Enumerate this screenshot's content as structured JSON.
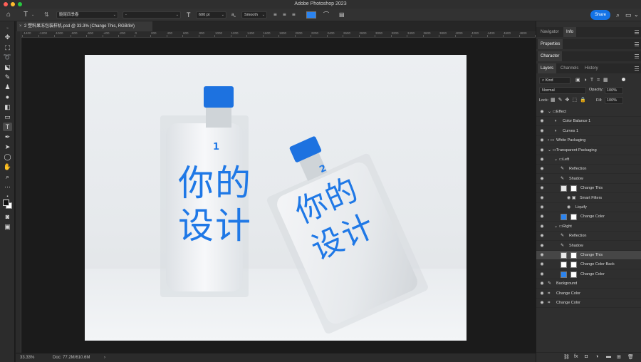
{
  "window": {
    "title": "Adobe Photoshop 2023"
  },
  "options": {
    "font_family": "髓尾四季春",
    "font_style": "-",
    "font_size": "600 pt",
    "antialias_label": "a",
    "antialias": "Smooth",
    "text_color": "#2b84f0",
    "share": "Share"
  },
  "document": {
    "tab_title": "2 塑料果冻包装样机.psd @ 33.3% (Change This, RGB/8#)",
    "zoom": "33.33%",
    "doc_size": "Doc: 77.2M/610.6M",
    "status_arrow": "›"
  },
  "rulers": {
    "top_labels": [
      "-1400",
      "-1200",
      "-1000",
      "-800",
      "-600",
      "-400",
      "-200",
      "0",
      "200",
      "400",
      "600",
      "800",
      "1000",
      "1200",
      "1400",
      "1600",
      "1800",
      "2000",
      "2200",
      "2400",
      "2600",
      "2800",
      "3000",
      "3200",
      "3400",
      "3600",
      "3800",
      "4000",
      "4200",
      "4400",
      "4600",
      "4800",
      "5000",
      "5200"
    ]
  },
  "artwork": {
    "left_number": "1",
    "right_number": "2",
    "line1": "你的",
    "line2": "设计",
    "text_color": "#1f78e6",
    "cap_color": "#1d72e0"
  },
  "panels": {
    "top_tabs": [
      "Navigator",
      "Info"
    ],
    "properties": "Properties",
    "character": "Character",
    "layer_tabs": [
      "Layers",
      "Channels",
      "History"
    ],
    "filter_kind": "Kind",
    "blend_mode": "Normal",
    "opacity_label": "Opacity:",
    "opacity": "100%",
    "lock_label": "Lock:",
    "fill_label": "Fill:",
    "fill": "100%"
  },
  "layers": [
    {
      "name": "Effect",
      "kind": "group-open"
    },
    {
      "name": "Color Balance 1",
      "kind": "adjust"
    },
    {
      "name": "Curves 1",
      "kind": "adjust"
    },
    {
      "name": "White Packaging",
      "kind": "group-closed"
    },
    {
      "name": "Transparent Packaging",
      "kind": "group-open"
    },
    {
      "name": "Left",
      "kind": "group-open"
    },
    {
      "name": "Reflection",
      "kind": "brush"
    },
    {
      "name": "Shadow",
      "kind": "brush"
    },
    {
      "name": "Change This",
      "kind": "smart"
    },
    {
      "name": "Smart Filters",
      "kind": "filter"
    },
    {
      "name": "Liquify",
      "kind": "filter-item"
    },
    {
      "name": "Change Color",
      "kind": "fill-blue"
    },
    {
      "name": "Right",
      "kind": "group-open"
    },
    {
      "name": "Reflection",
      "kind": "brush"
    },
    {
      "name": "Shadow",
      "kind": "brush"
    },
    {
      "name": "Change This",
      "kind": "smart-selected"
    },
    {
      "name": "Change Color Back",
      "kind": "fill-white"
    },
    {
      "name": "Change Color",
      "kind": "fill-blue"
    },
    {
      "name": "Background",
      "kind": "brush"
    },
    {
      "name": "Change Color",
      "kind": "shape"
    },
    {
      "name": "Change Color",
      "kind": "shape"
    }
  ]
}
